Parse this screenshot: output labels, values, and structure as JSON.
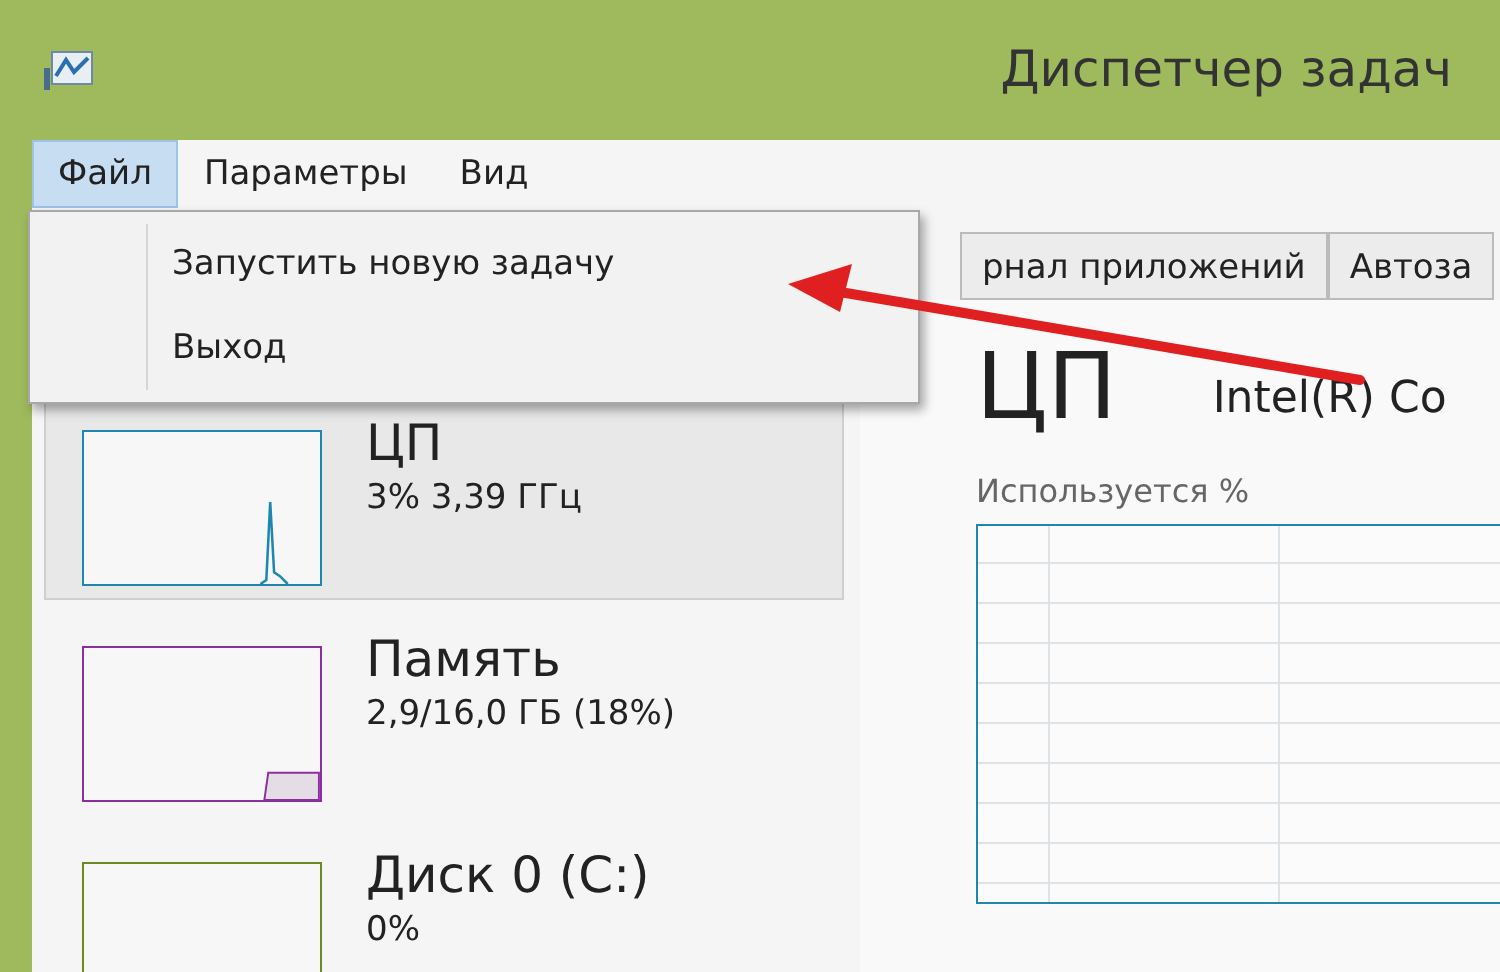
{
  "window": {
    "title": "Диспетчер задач"
  },
  "menu_bar": [
    {
      "label": "Файл",
      "selected": true
    },
    {
      "label": "Параметры",
      "selected": false
    },
    {
      "label": "Вид",
      "selected": false
    }
  ],
  "file_menu": {
    "items": [
      "Запустить новую задачу",
      "Выход"
    ]
  },
  "tabs": [
    {
      "label": "рнал приложений",
      "selected": false
    },
    {
      "label": "Автоза",
      "selected": false
    }
  ],
  "resources": [
    {
      "kind": "cpu",
      "name": "ЦП",
      "detail": "3% 3,39 ГГц",
      "selected": true,
      "color": "#1f86b0"
    },
    {
      "kind": "memory",
      "name": "Память",
      "detail": "2,9/16,0 ГБ (18%)",
      "selected": false,
      "color": "#8b2f9c"
    },
    {
      "kind": "disk",
      "name": "Диск 0 (C:)",
      "detail": "0%",
      "selected": false,
      "color": "#6b8a23"
    }
  ],
  "detail": {
    "title": "ЦП",
    "processor": "Intel(R) Co",
    "chart_caption": "Используется %"
  }
}
